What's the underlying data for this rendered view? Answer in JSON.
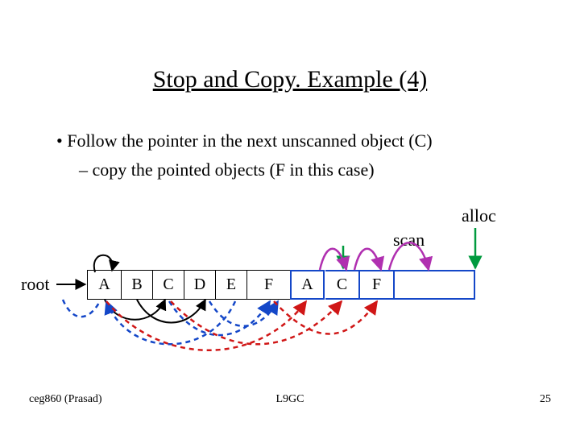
{
  "title": "Stop and Copy. Example (4)",
  "bullet1": "•  Follow the pointer in the next unscanned object (C)",
  "bullet2": "–  copy the pointed objects (F in this case)",
  "labels": {
    "scan": "scan",
    "alloc": "alloc",
    "root": "root"
  },
  "cells": {
    "from": [
      "A",
      "B",
      "C",
      "D",
      "E",
      "F"
    ],
    "to": [
      "A",
      "C",
      "F",
      ""
    ]
  },
  "cellWidths": {
    "from": [
      43,
      39,
      39,
      39,
      39,
      54
    ],
    "to": [
      43,
      43,
      43,
      100
    ]
  },
  "footer": {
    "left": "ceg860 (Prasad)",
    "center": "L9GC",
    "right": "25"
  },
  "colors": {
    "scanArrow": "#009a3e",
    "allocArrow": "#009a3e",
    "forward": "#d01616",
    "newPtr": "#b030b0",
    "oldPtr": "#1447c8"
  }
}
